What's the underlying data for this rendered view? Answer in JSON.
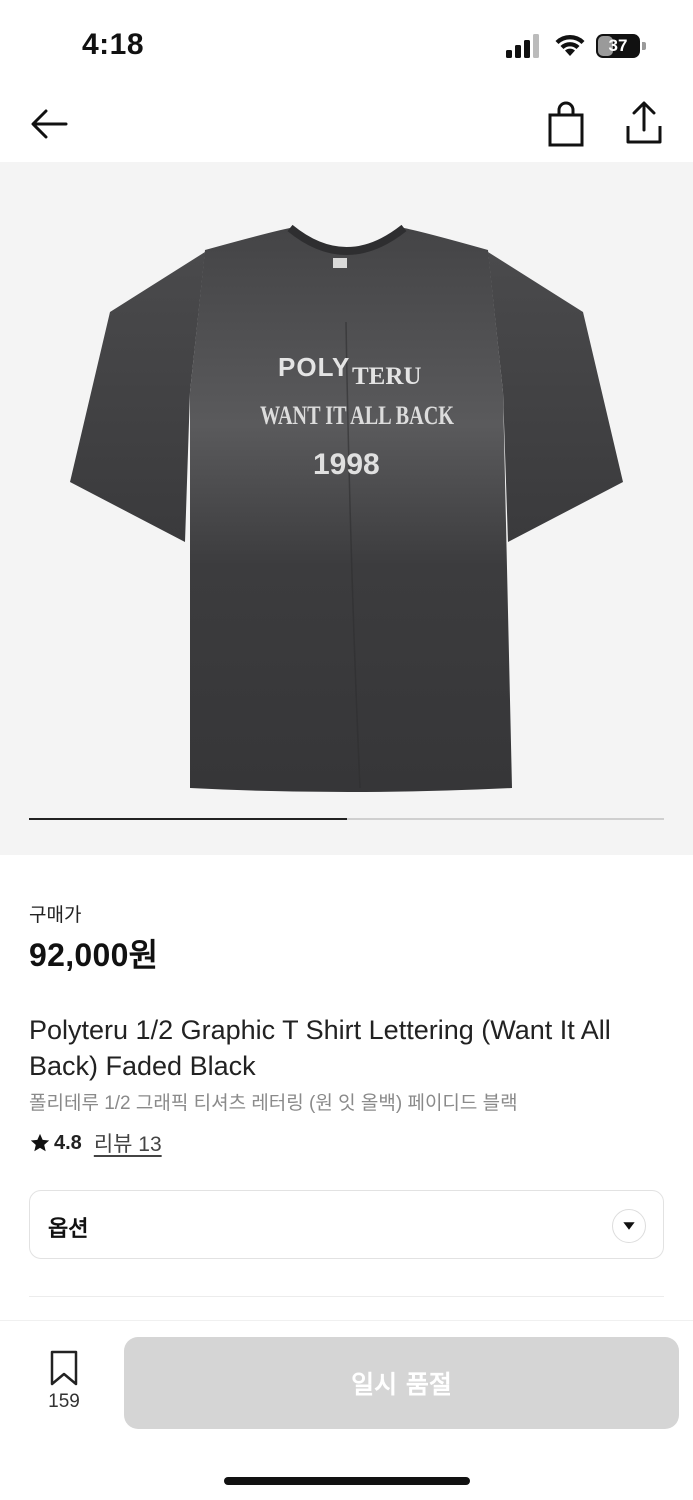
{
  "status_bar": {
    "time": "4:18",
    "battery_level": "37",
    "battery_fraction": 0.37
  },
  "nav": {
    "back_icon": "arrow-left-icon",
    "bag_icon": "shopping-bag-icon",
    "share_icon": "share-icon"
  },
  "gallery": {
    "image_subject": "t-shirt-image",
    "shirt_text": {
      "line1_left": "POLY",
      "line1_right": "TERU",
      "line2": "WANT IT ALL BACK",
      "line3": "1998"
    },
    "progress_fraction": 0.5
  },
  "product": {
    "price_label": "구매가",
    "price": "92,000원",
    "title_en": "Polyteru 1/2 Graphic T Shirt Lettering (Want It All Back) Faded Black",
    "title_ko": "폴리테루 1/2 그래픽 티셔츠 레터링 (원 잇 올백) 페이디드 블랙",
    "rating": "4.8",
    "review_link": "리뷰 13"
  },
  "option": {
    "label": "옵션",
    "dropdown_icon": "chevron-down-icon"
  },
  "bottom_bar": {
    "bookmark_icon": "bookmark-icon",
    "bookmark_count": "159",
    "soldout_label": "일시 품절"
  },
  "colors": {
    "shirt": "#3a3a3c",
    "background_gallery": "#f4f4f4",
    "disabled_button": "#d5d5d5"
  }
}
